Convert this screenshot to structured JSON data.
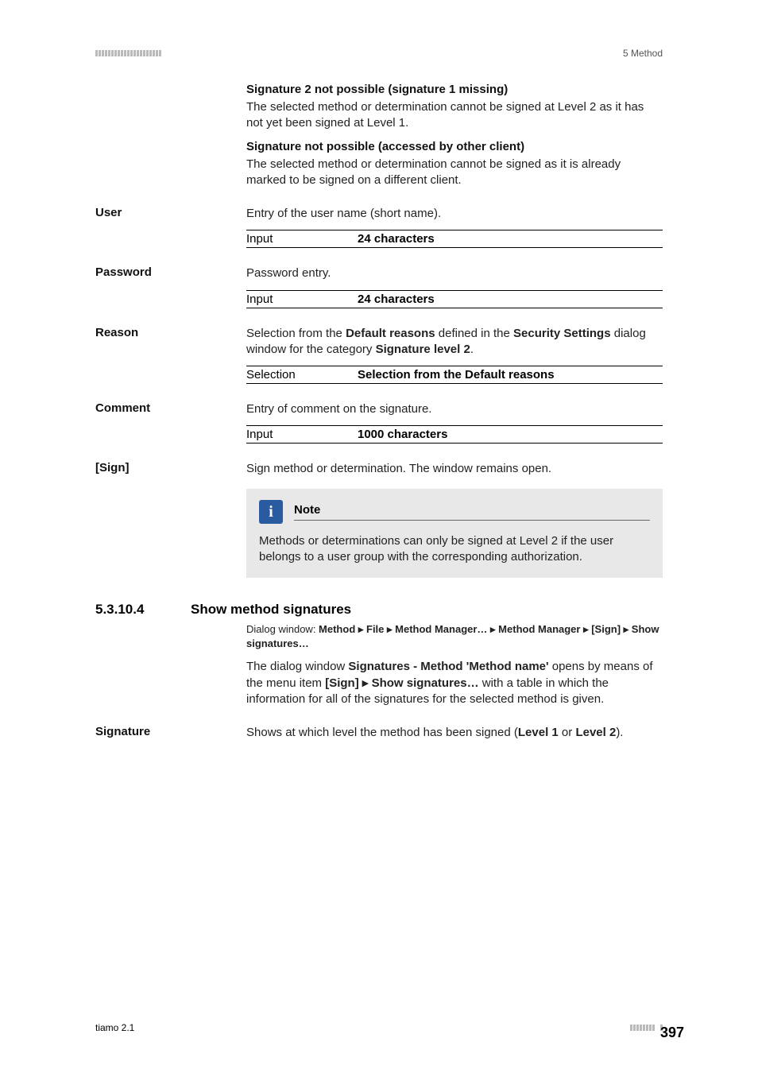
{
  "header": {
    "chapter": "5 Method"
  },
  "blocks": {
    "sig2_heading": "Signature 2 not possible (signature 1 missing)",
    "sig2_body": "The selected method or determination cannot be signed at Level 2 as it has not yet been signed at Level 1.",
    "signot_heading": "Signature not possible (accessed by other client)",
    "signot_body": "The selected method or determination cannot be signed as it is already marked to be signed on a different client."
  },
  "fields": {
    "user": {
      "label": "User",
      "desc": "Entry of the user name (short name).",
      "k": "Input",
      "v": "24 characters"
    },
    "password": {
      "label": "Password",
      "desc": "Password entry.",
      "k": "Input",
      "v": "24 characters"
    },
    "reason": {
      "label": "Reason",
      "desc_pre": "Selection from the ",
      "desc_b1": "Default reasons",
      "desc_mid": " defined in the ",
      "desc_b2": "Security Settings",
      "desc_post1": " dialog window for the category ",
      "desc_b3": "Signature level 2",
      "desc_end": ".",
      "k": "Selection",
      "v": "Selection from the Default reasons"
    },
    "comment": {
      "label": "Comment",
      "desc": "Entry of comment on the signature.",
      "k": "Input",
      "v": "1000 characters"
    },
    "sign": {
      "label": "[Sign]",
      "desc": "Sign method or determination. The window remains open."
    }
  },
  "note": {
    "title": "Note",
    "body": "Methods or determinations can only be signed at Level 2 if the user belongs to a user group with the corresponding authorization."
  },
  "section": {
    "num": "5.3.10.4",
    "title": "Show method signatures",
    "dialog_prefix": "Dialog window: ",
    "dialog_path": "Method ▸ File ▸ Method Manager… ▸ Method Manager ▸ [Sign] ▸ Show signatures…",
    "p_pre": "The dialog window ",
    "p_b1": "Signatures - Method 'Method name'",
    "p_mid1": " opens by means of the menu item ",
    "p_b2": "[Sign] ▸ Show signatures…",
    "p_post": " with a table in which the information for all of the signatures for the selected method is given."
  },
  "signature": {
    "label": "Signature",
    "desc_pre": "Shows at which level the method has been signed (",
    "desc_b1": "Level 1",
    "desc_mid": " or ",
    "desc_b2": "Level 2",
    "desc_end": ")."
  },
  "footer": {
    "product": "tiamo 2.1",
    "page": "397"
  }
}
